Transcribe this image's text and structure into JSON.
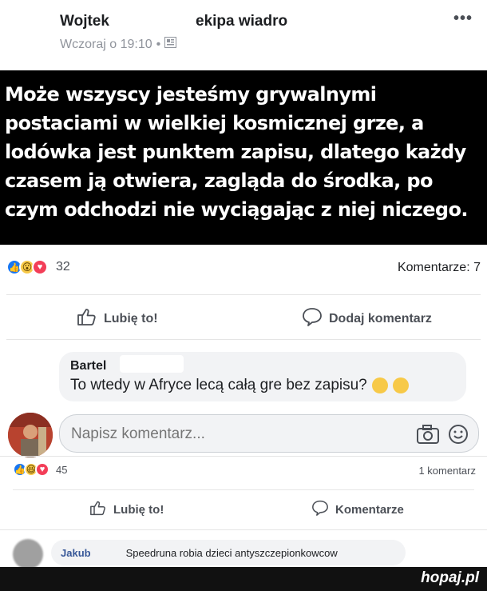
{
  "post": {
    "author": "Wojtek",
    "group": "ekipa wiadro",
    "timestamp": "Wczoraj o 19:10",
    "more_label": "•••",
    "quote": "Może wszyscy jesteśmy grywalnymi\npostaciami w wielkiej kosmicznej grze, a\nlodówka jest punktem zapisu, dlatego każdy\nczasem ją otwiera, zagląda do środka, po\nczym odchodzi nie wyciągając z niej niczego.",
    "reactions_count": "32",
    "comments_count": "Komentarze: 7",
    "like_label": "Lubię to!",
    "comment_label": "Dodaj komentarz"
  },
  "comment": {
    "name": "Bartel",
    "text": "To wtedy w Afryce lecą całą gre bez zapisu?"
  },
  "composer": {
    "placeholder": "Napisz komentarz..."
  },
  "second_post": {
    "reactions_count": "45",
    "comments_count": "1 komentarz",
    "like_label": "Lubię to!",
    "comment_label": "Komentarze"
  },
  "reply": {
    "name": "Jakub",
    "text": "Speedruna robia dzieci antyszczepionkowcow"
  },
  "watermark": "hopaj.pl",
  "colors": {
    "like": "#1877f2",
    "love": "#f33e58",
    "wow": "#f7c948",
    "text": "#1c1e21",
    "muted": "#90949c"
  }
}
